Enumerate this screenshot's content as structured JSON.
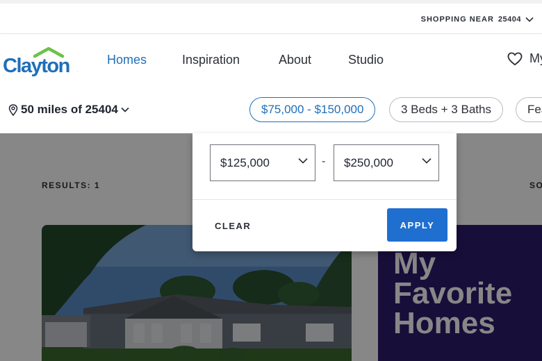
{
  "shop": {
    "label": "SHOPPING NEAR",
    "zip": "25404"
  },
  "brand": {
    "name": "Clayton",
    "roof_color": "#6cc24a",
    "text_color": "#1f6fb8"
  },
  "nav": {
    "items": [
      {
        "label": "Homes",
        "active": true
      },
      {
        "label": "Inspiration",
        "active": false
      },
      {
        "label": "About",
        "active": false
      },
      {
        "label": "Studio",
        "active": false
      }
    ],
    "favorites_label": "My"
  },
  "filters": {
    "location": "50 miles of 25404",
    "price_pill": "$75,000 - $150,000",
    "beds_pill": "3 Beds + 3 Baths",
    "features_pill": "Fea"
  },
  "price_dropdown": {
    "min_value": "$125,000",
    "max_value": "$250,000",
    "separator": "-",
    "clear_label": "CLEAR",
    "apply_label": "APPLY"
  },
  "results": {
    "label": "RESULTS: 1",
    "sort_label": "SO"
  },
  "promo": {
    "title": "My\nFavorite\nHomes"
  },
  "colors": {
    "accent": "#1f6fb8",
    "apply": "#1f6fd0",
    "promo_bg": "#2c1c6e"
  }
}
